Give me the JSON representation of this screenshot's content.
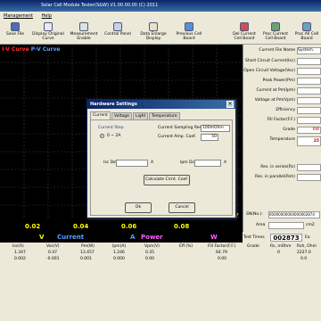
{
  "window": {
    "title": "Solar Cell Module Tester(S&W) V1.00.00.00 (C) 2011"
  },
  "menu": [
    "Management",
    "Help"
  ],
  "toolbar": {
    "save_file": "Save File",
    "display_original_curve": "Display Original Curve",
    "measurement_enable": "Measurement Enable",
    "control_panel": "Control Panel",
    "data_enlarge_display": "Data Enlarge Display",
    "previous_cell_board": "Previous Cell Board",
    "del_current_cell_board": "Del Current Cell Board",
    "proc_current_cell_board": "Proc Current Cell Board",
    "proc_all_cell_board": "Proc All Cell Board"
  },
  "chart": {
    "legend_iv": "I-V Curve",
    "legend_pv": "P-V Curve",
    "x_ticks": [
      "0.02",
      "0.04",
      "0.06",
      "0.08"
    ],
    "x_unit": "V",
    "colors": {
      "background": "#000000",
      "grid": "#3a3a3a",
      "tick": "#ffff00",
      "iv": "#ff3030",
      "pv": "#5aa0ff"
    }
  },
  "side_panel": {
    "current_file_name_label": "Current File Name",
    "current_file_name_value": "System.",
    "rows": [
      {
        "label": "Short Circuit Current(Isc)",
        "value": ""
      },
      {
        "label": "Open Circuit Voltage(Voc)",
        "value": ""
      },
      {
        "label": "Peak Power(Pm)",
        "value": ""
      },
      {
        "label": "Current at Pm(Ipm)",
        "value": ""
      },
      {
        "label": "Voltage at Pm(Vpm)",
        "value": ""
      },
      {
        "label": "Efficiency",
        "value": ""
      },
      {
        "label": "Fill Factor(F.F.)",
        "value": ""
      },
      {
        "label": "Grade",
        "value": "6W"
      },
      {
        "label": "Temperature",
        "value": "25"
      },
      {
        "label": "Res. in series(Rs)",
        "value": ""
      },
      {
        "label": "Res. in parallel(Rsh)",
        "value": ""
      }
    ],
    "sn_label": "SN(No.):",
    "sn_value": "00000000000000002874",
    "area_label": "Area",
    "area_value": "cm2",
    "test_times_label": "Test Times",
    "test_times_value": "002873",
    "test_times_unit": "Ea"
  },
  "bottom": {
    "legend": {
      "v": "V",
      "current": "Current",
      "a": "A",
      "power": "Power",
      "w": "W"
    },
    "headers": [
      "Isc(A)",
      "Voc(V)",
      "Pm(W)",
      "Ipm(A)",
      "Vpm(V)",
      "Eff.(%)",
      "Fill Factor(F.F.)",
      "Grade",
      "Rs, mOhm",
      "Rsh, Ohm"
    ],
    "row1": [
      "1.347",
      "0.47",
      "13.457",
      "1.246",
      "0.35",
      "",
      "64.79",
      "",
      "0",
      "2227.0"
    ],
    "row2": [
      "0.002",
      "-0.001",
      "0.001",
      "0.000",
      "0.00",
      "",
      "0.00",
      "",
      "",
      "0.0"
    ]
  },
  "dialog": {
    "title": "Hardware Settings",
    "tabs": [
      "Current",
      "Voltage",
      "Light",
      "Temperature"
    ],
    "current_step_label": "Current Step",
    "current_step_option": "0 ~ 2A",
    "current_sampling_res_label": "Current Sampling Res.",
    "current_sampling_res_value": "100mOhm",
    "current_amp_coef_label": "Current Amp. Coef.",
    "current_amp_coef_value": "50",
    "isc_dst_label": "Isc Dst.",
    "isc_dst_unit": "A",
    "ipm_dst_label": "Ipm Dst.",
    "ipm_dst_unit": "A",
    "calculate_label": "Calculate Crrnt. Coef.",
    "ok_label": "Ok",
    "cancel_label": "Cancel"
  }
}
